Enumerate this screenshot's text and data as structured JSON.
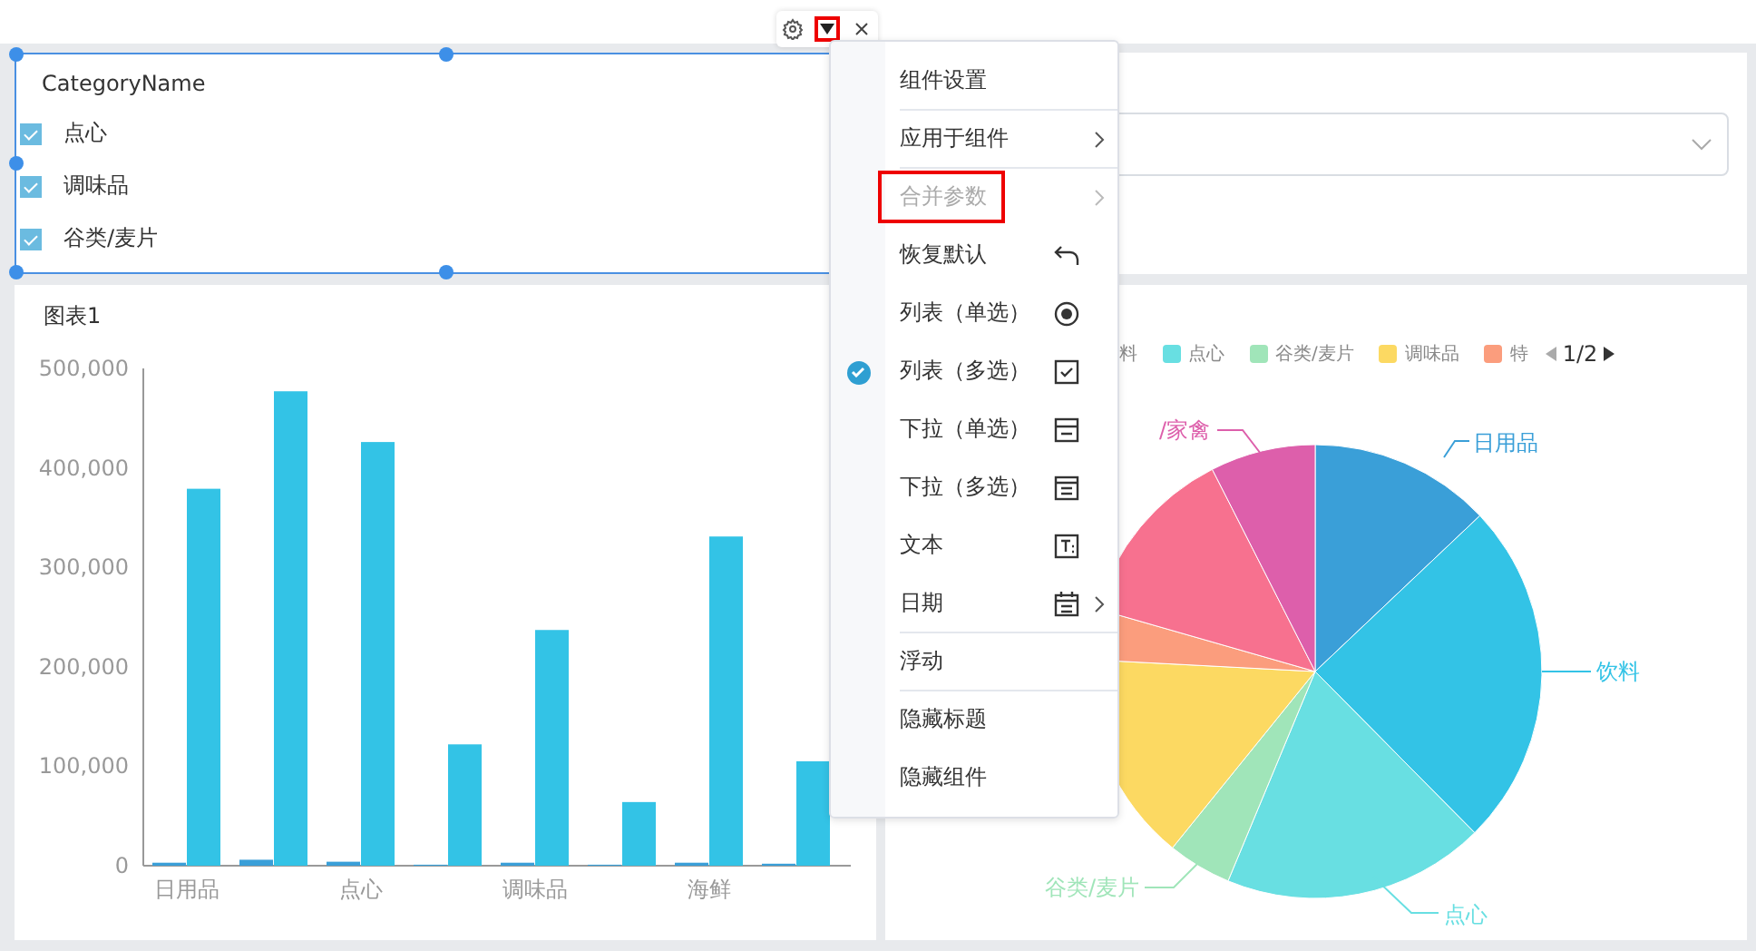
{
  "toolbar": {
    "caret_outlined": true
  },
  "filter_panel": {
    "selected": true,
    "title": "CategoryName",
    "items": [
      {
        "label": "点心",
        "checked": true
      },
      {
        "label": "调味品",
        "checked": true
      },
      {
        "label": "谷类/麦片",
        "checked": true
      }
    ]
  },
  "bar_panel": {
    "title": "图表1",
    "chart_data": {
      "type": "bar",
      "stacked": false,
      "categories": [
        "日用品",
        null,
        "点心",
        null,
        "调味品",
        null,
        "海鲜",
        null
      ],
      "series": [
        {
          "color": "#3a9fd8",
          "values": [
            3000,
            6000,
            4000,
            1000,
            3000,
            1000,
            3000,
            2000
          ]
        },
        {
          "color": "#33c3e6",
          "values": [
            379000,
            477000,
            426000,
            122000,
            237000,
            64000,
            331000,
            105000
          ]
        }
      ],
      "ylim": [
        0,
        500000
      ],
      "yticks": [
        {
          "value": 0,
          "label": "0"
        },
        {
          "value": 100000,
          "label": "100,000"
        },
        {
          "value": 200000,
          "label": "200,000"
        },
        {
          "value": 300000,
          "label": "300,000"
        },
        {
          "value": 400000,
          "label": "400,000"
        },
        {
          "value": 500000,
          "label": "500,000"
        }
      ]
    }
  },
  "pie_panel": {
    "legend": [
      {
        "label": "料"
      },
      {
        "label": "点心",
        "color": "#68dfe2"
      },
      {
        "label": "谷类/麦片",
        "color": "#a0e5b9"
      },
      {
        "label": "调味品",
        "color": "#fcd962"
      },
      {
        "label": "特",
        "color": "#fb9d7d"
      }
    ],
    "pager": "1/2",
    "labels": [
      {
        "label": "日用品",
        "color": "#3a9fd8"
      },
      {
        "label": "饮料",
        "color": "#33c3e6"
      },
      {
        "label": "点心",
        "color": "#68dfe2"
      },
      {
        "label": "谷类/麦片",
        "color": "#a0e5b9"
      },
      {
        "label": "/家禽",
        "color": "#dd5fab"
      }
    ]
  },
  "menu": {
    "items": [
      {
        "label": "组件设置",
        "kind": "plain",
        "submenu": false,
        "disabled": false,
        "selected": false,
        "outlined": false,
        "divider_after": true
      },
      {
        "label": "应用于组件",
        "kind": "plain",
        "submenu": true,
        "disabled": false,
        "selected": false,
        "outlined": false,
        "divider_after": true
      },
      {
        "label": "合并参数",
        "kind": "plain",
        "submenu": true,
        "disabled": true,
        "selected": false,
        "outlined": true,
        "divider_after": false
      },
      {
        "label": "恢复默认",
        "kind": "restore",
        "submenu": false,
        "disabled": false,
        "selected": false,
        "outlined": false,
        "divider_after": false
      },
      {
        "label": "列表（单选）",
        "kind": "list-single",
        "submenu": false,
        "disabled": false,
        "selected": false,
        "outlined": false,
        "divider_after": false
      },
      {
        "label": "列表（多选）",
        "kind": "list-multi",
        "submenu": false,
        "disabled": false,
        "selected": true,
        "outlined": false,
        "divider_after": false
      },
      {
        "label": "下拉（单选）",
        "kind": "dropdown-single",
        "submenu": false,
        "disabled": false,
        "selected": false,
        "outlined": false,
        "divider_after": false
      },
      {
        "label": "下拉（多选）",
        "kind": "dropdown-multi",
        "submenu": false,
        "disabled": false,
        "selected": false,
        "outlined": false,
        "divider_after": false
      },
      {
        "label": "文本",
        "kind": "text",
        "submenu": false,
        "disabled": false,
        "selected": false,
        "outlined": false,
        "divider_after": false
      },
      {
        "label": "日期",
        "kind": "date",
        "submenu": true,
        "disabled": false,
        "selected": false,
        "outlined": false,
        "divider_after": true
      },
      {
        "label": "浮动",
        "kind": "plain",
        "submenu": false,
        "disabled": false,
        "selected": false,
        "outlined": false,
        "divider_after": true
      },
      {
        "label": "隐藏标题",
        "kind": "plain",
        "submenu": false,
        "disabled": false,
        "selected": false,
        "outlined": false,
        "divider_after": false
      },
      {
        "label": "隐藏组件",
        "kind": "plain",
        "submenu": false,
        "disabled": false,
        "selected": false,
        "outlined": false,
        "divider_after": false
      }
    ]
  }
}
